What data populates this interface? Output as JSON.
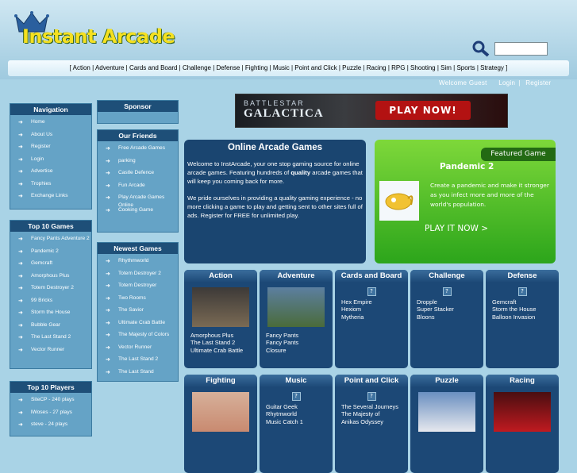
{
  "header": {
    "logo": "Instant Arcade",
    "search_placeholder": ""
  },
  "categories": [
    "Action",
    "Adventure",
    "Cards and Board",
    "Challenge",
    "Defense",
    "Fighting",
    "Music",
    "Point and Click",
    "Puzzle",
    "Racing",
    "RPG",
    "Shooting",
    "Sim",
    "Sports",
    "Strategy"
  ],
  "user": {
    "welcome": "Welcome Guest",
    "login": "Login",
    "register": "Register"
  },
  "navigation": {
    "title": "Navigation",
    "items": [
      "Home",
      "About Us",
      "Register",
      "Login",
      "Advertise",
      "Trophies",
      "Exchange Links"
    ]
  },
  "sponsor": {
    "title": "Sponsor"
  },
  "friends": {
    "title": "Our Friends",
    "items": [
      "Free Arcade Games",
      "parking",
      "Castle Defence",
      "Fun Arcade",
      "Play Arcade Games Online",
      "Cooking Game"
    ]
  },
  "top10games": {
    "title": "Top 10 Games",
    "items": [
      "Fancy Pants Adventure 2",
      "Pandemic 2",
      "Gemcraft",
      "Amorphous Plus",
      "Totem Destroyer 2",
      "99 Bricks",
      "Storm the House",
      "Bubble Gear",
      "The Last Stand 2",
      "Vector Runner"
    ]
  },
  "newest": {
    "title": "Newest Games",
    "items": [
      "Rhythmworld",
      "Totem Destroyer 2",
      "Totem Destroyer",
      "Two Rooms",
      "The Savior",
      "Ultimate Crab Battle",
      "The Majesty of Colors",
      "Vector Runner",
      "The Last Stand 2",
      "The Last Stand"
    ]
  },
  "top10players": {
    "title": "Top 10 Players",
    "items": [
      "SiteCP - 240 plays",
      "lWoses - 27 plays",
      "steve - 24 plays"
    ]
  },
  "banner": {
    "top": "BATTLESTAR",
    "main": "GALACTICA",
    "cta": "PLAY NOW!"
  },
  "online": {
    "title": "Online Arcade Games",
    "p1a": "Welcome to InstArcade, your one stop gaming source for online arcade games. Featuring hundreds of ",
    "p1b": "quality",
    "p1c": " arcade games that will keep you coming back for more.",
    "p2": "We pride ourselves in providing a quality gaming experience - no more clicking a game to play and getting sent to other sites full of ads. Register for FREE for unlimited play."
  },
  "featured": {
    "tab": "Featured Game",
    "title": "Pandemic 2",
    "desc": "Create a pandemic and make it stronger as you infect more and more of the world's population.",
    "play": "PLAY IT NOW >"
  },
  "cat_boxes": [
    {
      "title": "Action",
      "games": [
        "Amorphous Plus",
        "The Last Stand 2",
        "Ultimate Crab Battle"
      ]
    },
    {
      "title": "Adventure",
      "games": [
        "Fancy Pants",
        "Fancy Pants",
        "Closure"
      ]
    },
    {
      "title": "Cards and Board",
      "games": [
        "Hex Empire",
        "Hexiom",
        "Mytheria"
      ]
    },
    {
      "title": "Challenge",
      "games": [
        "Dropple",
        "Super Stacker",
        "Bloons"
      ]
    },
    {
      "title": "Defense",
      "games": [
        "Gemcraft",
        "Storm the House",
        "Balloon Invasion"
      ]
    },
    {
      "title": "Fighting",
      "games": []
    },
    {
      "title": "Music",
      "games": [
        "Guitar Geek",
        "Rhytmworld",
        "Music Catch 1"
      ]
    },
    {
      "title": "Point and Click",
      "games": [
        "The Several Journeys",
        "The Majesty of",
        "Anikas Odyssey"
      ]
    },
    {
      "title": "Puzzle",
      "games": []
    },
    {
      "title": "Racing",
      "games": []
    }
  ],
  "colors": {
    "primary": "#1c4876",
    "featured": "#43b726",
    "bg": "#a9d3e6"
  }
}
